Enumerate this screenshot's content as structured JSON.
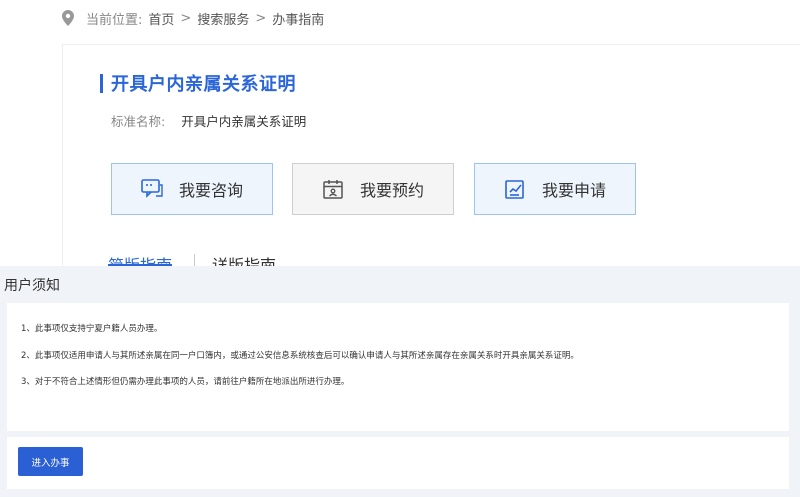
{
  "breadcrumb": {
    "prefix": "当前位置:",
    "items": [
      "首页",
      "搜索服务",
      "办事指南"
    ],
    "separator": ">"
  },
  "page": {
    "title": "开具户内亲属关系证明",
    "standard_name_label": "标准名称:",
    "standard_name_value": "开具户内亲属关系证明"
  },
  "actions": [
    {
      "label": "我要咨询",
      "icon": "chat-icon"
    },
    {
      "label": "我要预约",
      "icon": "calendar-icon"
    },
    {
      "label": "我要申请",
      "icon": "edit-form-icon"
    }
  ],
  "tabs": [
    {
      "label": "简版指南",
      "active": true
    },
    {
      "label": "详版指南",
      "active": false
    }
  ],
  "notice": {
    "title": "用户须知",
    "items": [
      "1、此事项仅支持宁夏户籍人员办理。",
      "2、此事项仅适用申请人与其所述亲属在同一户口簿内，或通过公安信息系统核查后可以确认申请人与其所述亲属存在亲属关系时开具亲属关系证明。",
      "3、对于不符合上述情形但仍需办理此事项的人员，请前往户籍所在地派出所进行办理。"
    ],
    "button_label": "进入办事"
  },
  "colors": {
    "accent": "#2b66d9",
    "button": "#2b5fd4",
    "panel_bg": "#f0f3f7"
  }
}
